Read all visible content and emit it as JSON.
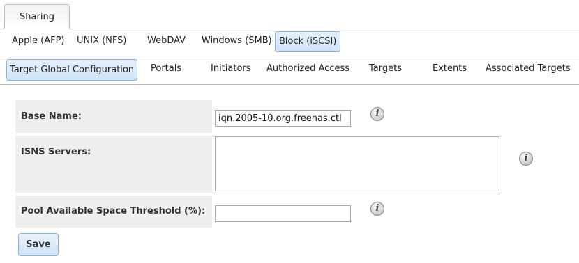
{
  "top_tabs": {
    "sharing": "Sharing"
  },
  "share_tabs": [
    {
      "label": "Apple (AFP)"
    },
    {
      "label": "UNIX (NFS)"
    },
    {
      "label": "WebDAV"
    },
    {
      "label": "Windows (SMB)"
    },
    {
      "label": "Block (iSCSI)",
      "active": true
    }
  ],
  "iscsi_tabs": [
    {
      "label": "Target Global Configuration",
      "active": true
    },
    {
      "label": "Portals"
    },
    {
      "label": "Initiators"
    },
    {
      "label": "Authorized Access"
    },
    {
      "label": "Targets"
    },
    {
      "label": "Extents"
    },
    {
      "label": "Associated Targets"
    }
  ],
  "form": {
    "base_name": {
      "label": "Base Name:",
      "value": "iqn.2005-10.org.freenas.ctl"
    },
    "isns_servers": {
      "label": "ISNS Servers:",
      "value": ""
    },
    "pool_threshold": {
      "label": "Pool Available Space Threshold (%):",
      "value": ""
    },
    "info_glyph": "i",
    "save_label": "Save"
  },
  "colors": {
    "active_tab_bg": "#cfe2f5",
    "active_tab_border": "#8bb3d9",
    "label_bg": "#efefef"
  },
  "icons": [
    "info-icon"
  ]
}
